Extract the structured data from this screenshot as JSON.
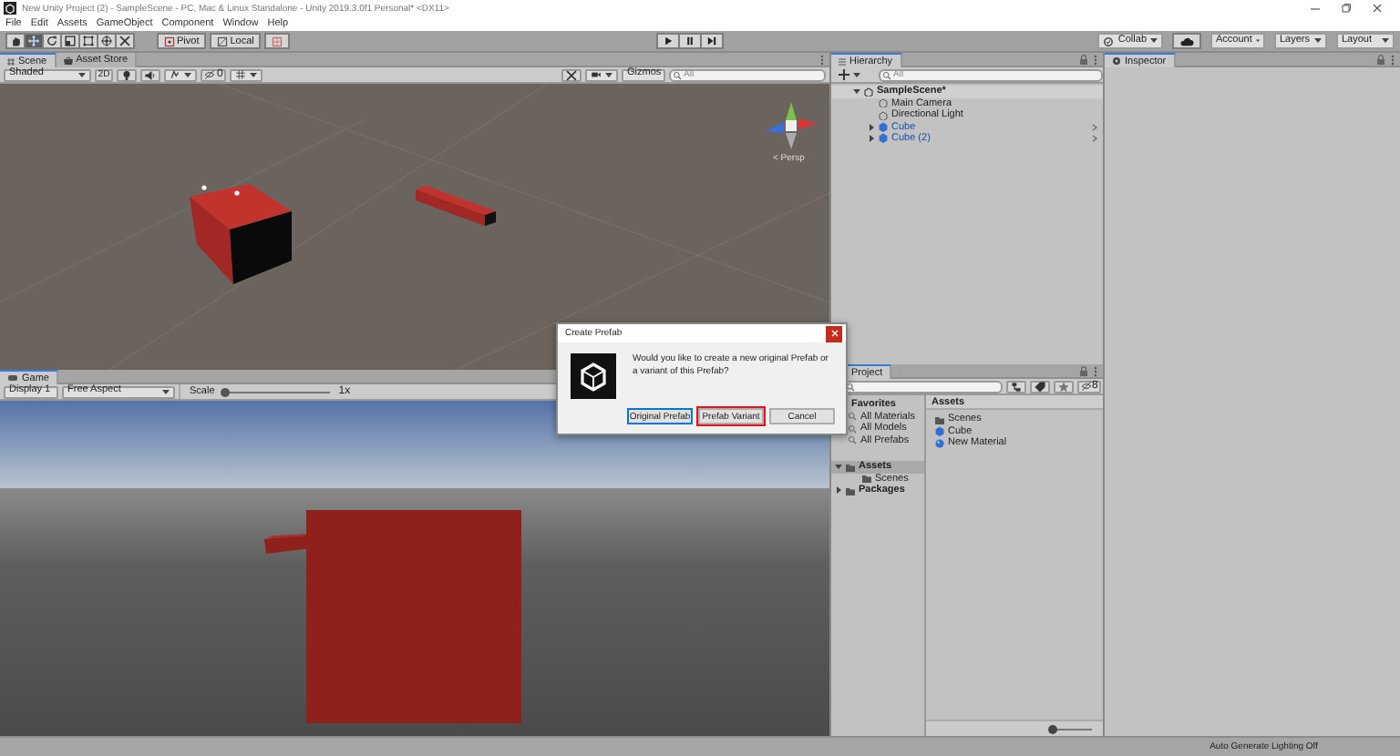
{
  "window": {
    "title": "New Unity Project (2) - SampleScene - PC, Mac & Linux Standalone - Unity 2019.3.0f1 Personal* <DX11>"
  },
  "menu": [
    "File",
    "Edit",
    "Assets",
    "GameObject",
    "Component",
    "Window",
    "Help"
  ],
  "toolbar": {
    "tools": [
      {
        "kind": "hand",
        "selected": false
      },
      {
        "kind": "move",
        "selected": true
      },
      {
        "kind": "rotate",
        "selected": false
      },
      {
        "kind": "scale",
        "selected": false
      },
      {
        "kind": "rect",
        "selected": false
      },
      {
        "kind": "transform",
        "selected": false
      },
      {
        "kind": "custom",
        "selected": false
      }
    ],
    "pivot": "Pivot",
    "space": "Local",
    "collab": "Collab",
    "account": "Account",
    "layers": "Layers",
    "layout": "Layout"
  },
  "scene": {
    "tabs": [
      {
        "label": "Scene",
        "kind": "scene",
        "selected": true
      },
      {
        "label": "Asset Store",
        "kind": "store",
        "selected": false
      }
    ],
    "shading": "Shaded",
    "mode_2d": "2D",
    "hidden_count": "0",
    "gizmos": "Gizmos",
    "search": {
      "placeholder": "All"
    },
    "view_label": "< Persp"
  },
  "game": {
    "tab": "Game",
    "display": "Display 1",
    "aspect": "Free Aspect",
    "scale_label": "Scale",
    "scale": {
      "level": 0.02
    },
    "scale_reading": "1x"
  },
  "hierarchy": {
    "tab": "Hierarchy",
    "search": {
      "placeholder": "All"
    },
    "tree": [
      {
        "label": "SampleScene*",
        "kind": "scene",
        "expanded": true,
        "children": [
          {
            "label": "Main Camera",
            "kind": "object"
          },
          {
            "label": "Directional Light",
            "kind": "object"
          },
          {
            "label": "Cube",
            "kind": "prefab",
            "expanded": false
          },
          {
            "label": "Cube (2)",
            "kind": "prefab",
            "expanded": false
          }
        ]
      }
    ]
  },
  "inspector": {
    "tab": "Inspector"
  },
  "project": {
    "tab": "Project",
    "hidden_count": "8",
    "favorites": {
      "label": "Favorites",
      "items": [
        "All Materials",
        "All Models",
        "All Prefabs"
      ]
    },
    "tree": [
      {
        "label": "Assets",
        "selected": true,
        "expanded": true,
        "children": [
          {
            "label": "Scenes",
            "selected": false
          }
        ]
      },
      {
        "label": "Packages",
        "selected": false,
        "expanded": false
      }
    ],
    "path": "Assets",
    "items": [
      {
        "label": "Scenes",
        "kind": "folder"
      },
      {
        "label": "Cube",
        "kind": "prefab"
      },
      {
        "label": "New Material",
        "kind": "material"
      }
    ],
    "zoom": {
      "level": 0
    }
  },
  "dialog": {
    "title": "Create Prefab",
    "message": "Would you like to create a new original Prefab or a variant of this Prefab?",
    "buttons": [
      {
        "label": "Original Prefab",
        "focused": true,
        "highlighted": false
      },
      {
        "label": "Prefab Variant",
        "focused": false,
        "highlighted": true
      },
      {
        "label": "Cancel",
        "focused": false,
        "highlighted": false
      }
    ]
  },
  "status_bar": {
    "text": "Auto Generate Lighting Off"
  }
}
